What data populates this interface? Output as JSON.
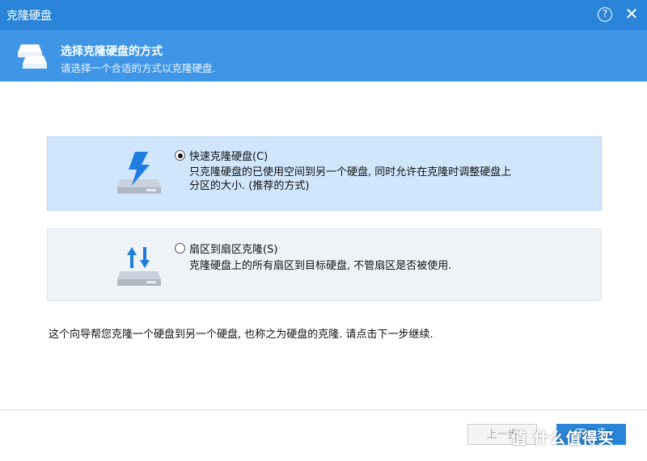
{
  "window": {
    "title": "克隆硬盘"
  },
  "header": {
    "title": "选择克隆硬盘的方式",
    "subtitle": "请选择一个合适的方式以克隆硬盘."
  },
  "options": [
    {
      "label": "快速克隆硬盘(C)",
      "description": "只克隆硬盘的已使用空间到另一个硬盘, 同时允许在克隆时调整硬盘上分区的大小. (推荐的方式)",
      "selected": true,
      "icon": "disk-lightning-icon"
    },
    {
      "label": "扇区到扇区克隆(S)",
      "description": "克隆硬盘上的所有扇区到目标硬盘, 不管扇区是否被使用.",
      "selected": false,
      "icon": "disk-arrows-icon"
    }
  ],
  "wizard_note": "这个向导帮您克隆一个硬盘到另一个硬盘, 也称之为硬盘的克隆. 请点击下一步继续.",
  "footer": {
    "prev_label": "上一步",
    "next_label": "下一步"
  },
  "watermark": "值 什么值得买",
  "colors": {
    "titlebar": "#2a85d8",
    "header": "#3f96e6",
    "selected_option": "#cfe6fc",
    "unselected_option": "#eef3f8",
    "accent_blue": "#1f7de0"
  }
}
